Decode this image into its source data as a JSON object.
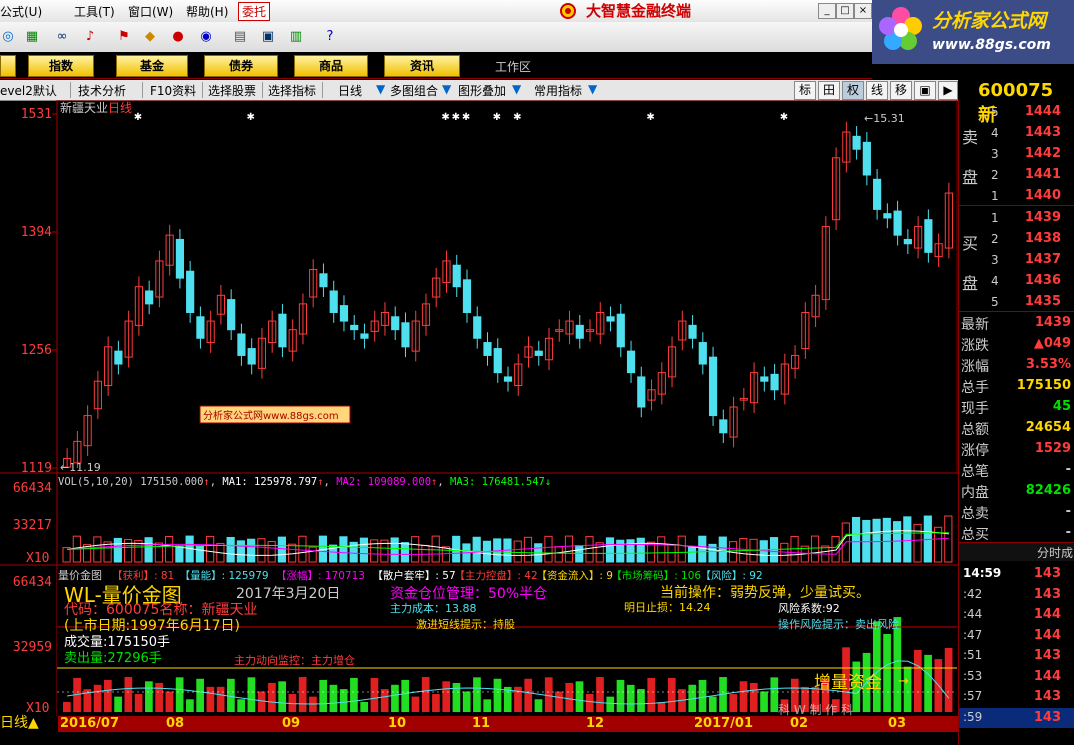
{
  "menu": {
    "items": [
      "公式(U)",
      "工具(T)",
      "窗口(W)",
      "帮助(H)"
    ],
    "trust": "委托",
    "app_title": "大智慧金融终端"
  },
  "brand": {
    "name": "分析家公式网",
    "url": "www.88gs.com"
  },
  "nav": {
    "buttons": [
      "指数",
      "基金",
      "债券",
      "商品",
      "资讯"
    ],
    "workspace": "工作区"
  },
  "subbar": {
    "items": [
      "evel2默认",
      "技术分析",
      "F10资料",
      "选择股票",
      "选择指标",
      "日线",
      "多图组合",
      "图形叠加",
      "常用指标"
    ],
    "right_items": [
      "标",
      "田",
      "权",
      "线",
      "移",
      "▣",
      "▶"
    ]
  },
  "stock": {
    "code": "600075",
    "code_suffix": "新",
    "name": "新疆天业",
    "period": "日线"
  },
  "price_chart": {
    "y_ticks": [
      "1531",
      "1394",
      "1256",
      "1119"
    ],
    "high_label": "15.31",
    "low_label": "11.19",
    "watermark": "分析家公式网www.88gs.com"
  },
  "vol_chart": {
    "header": "VOL(5,10,20)",
    "value": "175150.000",
    "ma1": "MA1: 125978.797",
    "ma2": "MA2: 109089.000",
    "ma3": "MA3: 176481.547",
    "y_ticks": [
      "66434",
      "33217"
    ],
    "x10": "X10"
  },
  "indicator": {
    "name": "量价金图",
    "tags": [
      "【获利】: 81",
      "【量能】: 125979",
      "【涨幅】: 170713",
      "【散户套牢】: 57",
      "【主力控盘】: 42",
      "【资金流入】: 9",
      "【市场筹码】: 106",
      "【风险】: 92"
    ],
    "title": "WL-量价金图",
    "date": "2017年3月20日",
    "position": "资金仓位管理：50%半仓",
    "operation": "当前操作：弱势反弹，少量试买。",
    "code_name": "代码：600075名称：新疆天业",
    "list_date": "(上市日期:1997年6月17日)",
    "cost": "主力成本：13.88",
    "short_hint": "激进短线提示：持股",
    "tomorrow_stop": "明日止损：14.24",
    "risk_coef": "风险系数:92",
    "op_risk": "操作风险提示：卖出风险",
    "volume": "成交量:175150手",
    "sell_volume": "卖出量:27296手",
    "main_monitor": "主力动向监控：主力增仓",
    "add_funds": "增量资金",
    "y_ticks": [
      "66434",
      "32959"
    ],
    "x10": "X10",
    "bottom_watermark": "科 W 制 作 科"
  },
  "order_book": {
    "sell_label": [
      "卖",
      "盘"
    ],
    "buy_label": [
      "买",
      "盘"
    ],
    "sells": [
      {
        "level": "5",
        "price": "1444"
      },
      {
        "level": "4",
        "price": "1443"
      },
      {
        "level": "3",
        "price": "1442"
      },
      {
        "level": "2",
        "price": "1441"
      },
      {
        "level": "1",
        "price": "1440"
      }
    ],
    "buys": [
      {
        "level": "1",
        "price": "1439"
      },
      {
        "level": "2",
        "price": "1438"
      },
      {
        "level": "3",
        "price": "1437"
      },
      {
        "level": "4",
        "price": "1436"
      },
      {
        "level": "5",
        "price": "1435"
      }
    ]
  },
  "quote": [
    {
      "label": "最新",
      "value": "1439",
      "color": "#ff3c3c"
    },
    {
      "label": "涨跌",
      "value": "▲049",
      "color": "#ff3c3c"
    },
    {
      "label": "涨幅",
      "value": "3.53%",
      "color": "#ff3c3c"
    },
    {
      "label": "总手",
      "value": "175150",
      "color": "#ffd700"
    },
    {
      "label": "现手",
      "value": "45",
      "color": "#00e000"
    },
    {
      "label": "总额",
      "value": "24654",
      "color": "#ffd700"
    },
    {
      "label": "涨停",
      "value": "1529",
      "color": "#ff3c3c"
    },
    {
      "label": "总笔",
      "value": "-",
      "color": "#cccccc"
    },
    {
      "label": "内盘",
      "value": "82426",
      "color": "#00e000"
    },
    {
      "label": "总卖",
      "value": "-",
      "color": "#cccccc"
    },
    {
      "label": "总买",
      "value": "-",
      "color": "#cccccc"
    }
  ],
  "time_share": {
    "title": "分时成",
    "first_time": "14:59"
  },
  "ticks": [
    {
      "time": "14:59",
      "price": "143"
    },
    {
      "time": ":42",
      "price": "143"
    },
    {
      "time": ":44",
      "price": "144"
    },
    {
      "time": ":47",
      "price": "144"
    },
    {
      "time": ":51",
      "price": "143"
    },
    {
      "time": ":53",
      "price": "144"
    },
    {
      "time": ":57",
      "price": "143"
    },
    {
      "time": ":59",
      "price": "143"
    }
  ],
  "date_axis": [
    "2016/07",
    "08",
    "09",
    "10",
    "11",
    "12",
    "2017/01",
    "02",
    "03"
  ],
  "bottom_label": "日线▲",
  "colors": {
    "up": "#ff3c3c",
    "down": "#4ee0ee",
    "vol_green": "#22dd22",
    "ma1": "#ffffff",
    "ma2": "#ff00ff",
    "ma3": "#00ff00"
  },
  "chart_data": {
    "type": "candlestick",
    "title": "新疆天业 日线",
    "ylim": [
      11.19,
      15.31
    ],
    "y_ticks": [
      15.31,
      13.94,
      12.56,
      11.19
    ],
    "x_range": [
      "2016/07",
      "2017/03"
    ],
    "series": [
      {
        "name": "close",
        "values": [
          11.3,
          11.5,
          11.8,
          12.2,
          12.6,
          12.4,
          12.9,
          13.3,
          13.1,
          13.6,
          13.9,
          13.4,
          13.0,
          12.7,
          12.9,
          13.2,
          12.8,
          12.5,
          12.4,
          12.7,
          12.9,
          12.6,
          12.8,
          13.1,
          13.5,
          13.3,
          13.0,
          12.9,
          12.8,
          12.7,
          12.9,
          13.0,
          12.8,
          12.6,
          12.9,
          13.1,
          13.4,
          13.6,
          13.3,
          13.0,
          12.7,
          12.5,
          12.3,
          12.2,
          12.4,
          12.6,
          12.5,
          12.7,
          12.8,
          12.9,
          12.7,
          12.8,
          13.0,
          12.9,
          12.6,
          12.3,
          11.9,
          12.1,
          12.3,
          12.6,
          12.9,
          12.7,
          12.4,
          11.8,
          11.6,
          11.9,
          12.0,
          12.3,
          12.2,
          12.1,
          12.4,
          12.5,
          13.0,
          13.2,
          14.0,
          14.8,
          15.1,
          14.9,
          14.6,
          14.2,
          14.1,
          13.9,
          13.8,
          14.0,
          13.7,
          13.8,
          14.39
        ]
      }
    ],
    "volume": {
      "current": 175150,
      "ma1": 125978.797,
      "ma2": 109089.0,
      "ma3": 176481.547,
      "ylim": [
        0,
        66434
      ]
    }
  }
}
